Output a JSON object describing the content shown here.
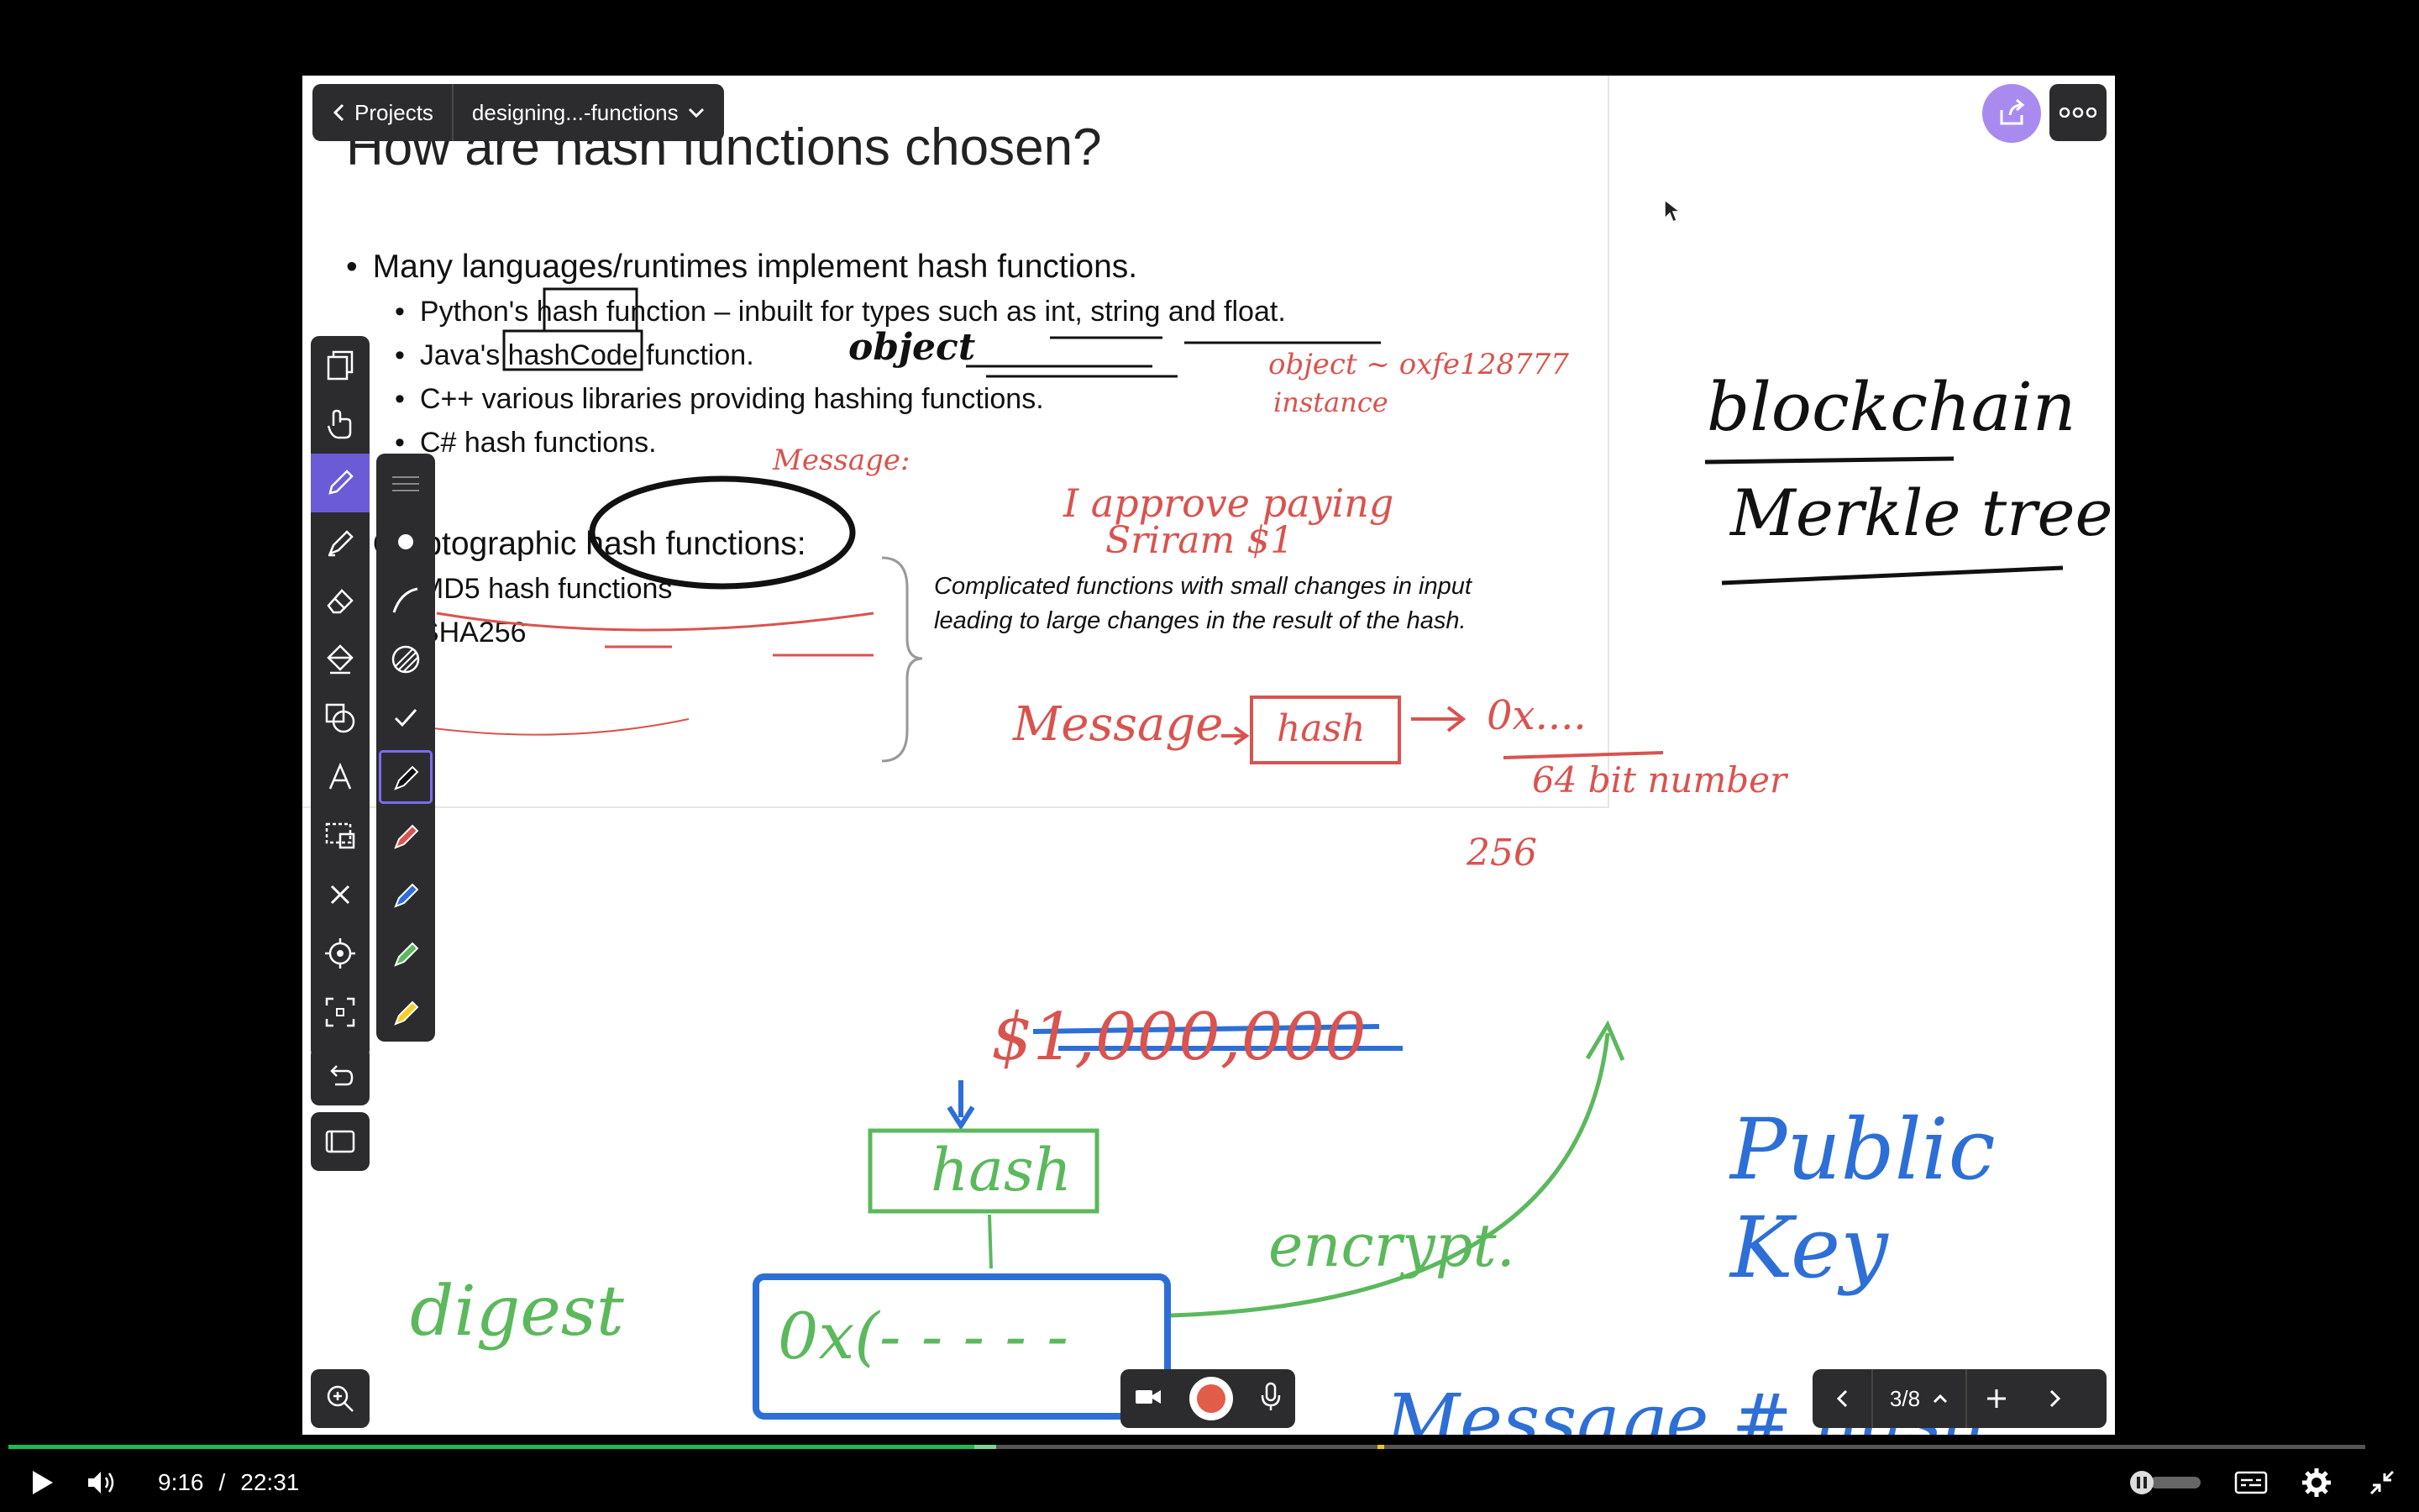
{
  "topbar": {
    "back_label": "Projects",
    "doc_title": "designing...-functions"
  },
  "slide": {
    "title": "How are hash functions chosen?",
    "bullets": [
      "Many languages/runtimes implement hash functions.",
      "Python's hash function – inbuilt for types such as int, string and float.",
      "Java's hashCode function.",
      "C++ various libraries providing hashing functions.",
      "C# hash functions.",
      "Cryptographic hash functions:",
      "MD5 hash functions",
      "SHA256"
    ],
    "note_line1": "Complicated functions with small changes in input",
    "note_line2": "leading to large changes in the result of the hash."
  },
  "annotations": {
    "object": "object",
    "object_instance_1": "object ~ oxfe128777",
    "object_instance_2": "instance",
    "message_label": "Message:",
    "message_text_1": "I approve paying",
    "message_text_2": "Sriram $1",
    "blockchain": "blockchain",
    "merkle_tree": "Merkle tree",
    "flow_message": "Message",
    "flow_hash": "hash",
    "flow_out": "0x....",
    "bit_number": "64 bit number",
    "bits_256": "256",
    "dollar": "$1,000,000",
    "hash_box": "hash",
    "digest": "digest",
    "digest_box": "0x(- - - - -",
    "encrypt": "encrypt.",
    "public_key": "Public Key",
    "bottom_text": "Message # hash"
  },
  "pager": {
    "page": "3/8"
  },
  "player": {
    "current_time": "9:16",
    "separator": "/",
    "duration": "22:31",
    "progress_percent": 41
  },
  "colors": {
    "ink_red": "#d9534f",
    "ink_blue": "#2d6fd6",
    "ink_green": "#5cb85c",
    "accent": "#6b5bd6",
    "share": "#a98bf0"
  }
}
